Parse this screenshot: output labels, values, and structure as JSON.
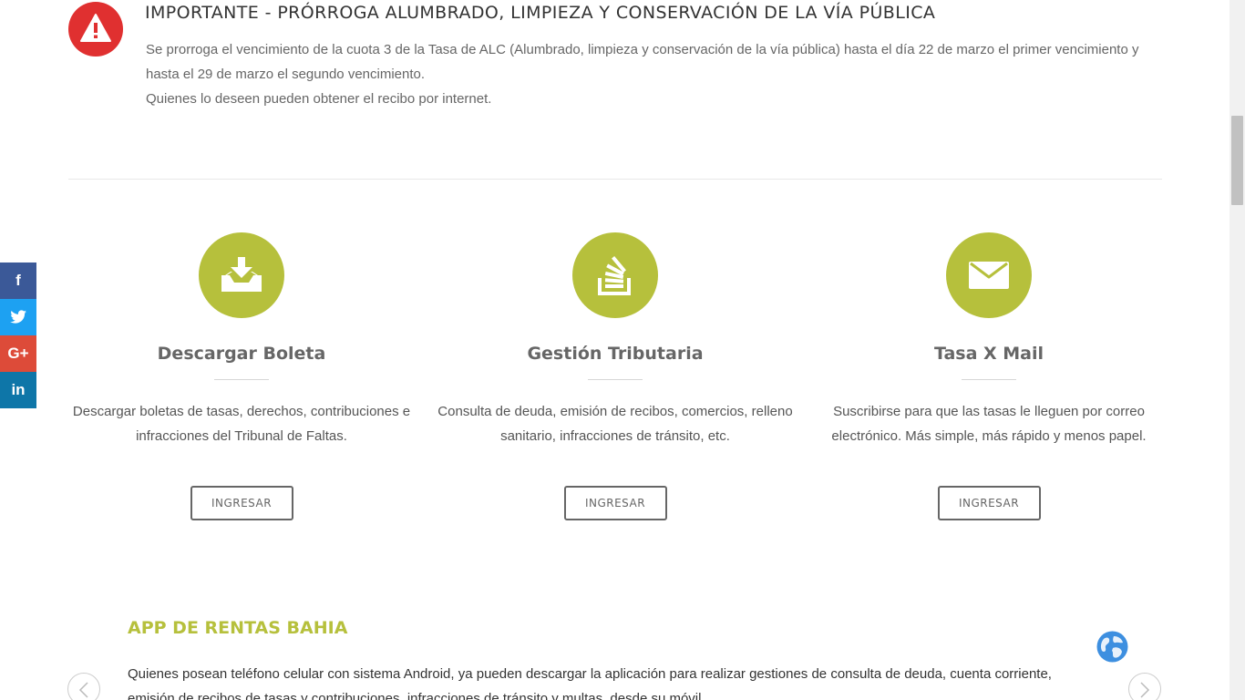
{
  "alert": {
    "title": "IMPORTANTE - PRÓRROGA ALUMBRADO, LIMPIEZA Y CONSERVACIÓN DE LA VÍA PÚBLICA",
    "body": "Se prorroga el vencimiento de la cuota 3 de la Tasa de ALC (Alumbrado, limpieza y conservación de la vía pública) hasta el día 22 de marzo el primer vencimiento y hasta el 29 de marzo el segundo vencimiento.",
    "note": "Quienes lo deseen pueden obtener el recibo por internet.",
    "icon": "warning-icon",
    "color": "#e03030"
  },
  "services": [
    {
      "icon": "download-inbox-icon",
      "title": "Descargar Boleta",
      "description": "Descargar boletas de tasas, derechos, contribuciones e infracciones del Tribunal de Faltas.",
      "button": "INGRESAR"
    },
    {
      "icon": "document-stack-icon",
      "title": "Gestión Tributaria",
      "description": "Consulta de deuda, emisión de recibos, comercios, relleno sanitario, infracciones de tránsito, etc.",
      "button": "INGRESAR"
    },
    {
      "icon": "envelope-icon",
      "title": "Tasa X Mail",
      "description": "Suscribirse para que las tasas le lleguen por correo electrónico. Más simple, más rápido y menos papel.",
      "button": "INGRESAR"
    }
  ],
  "app_section": {
    "title": "APP DE RENTAS BAHIA",
    "body": "Quienes posean teléfono celular con sistema Android, ya pueden descargar la aplicación para realizar gestiones de consulta de deuda, cuenta corriente, emisión de recibos de tasas y contribuciones, infracciones de tránsito y multas, desde su móvil."
  },
  "social": [
    {
      "name": "facebook",
      "label": "f",
      "color": "#3b5998"
    },
    {
      "name": "twitter",
      "label": "t",
      "color": "#1da1f2"
    },
    {
      "name": "google-plus",
      "label": "G+",
      "color": "#dd4b39"
    },
    {
      "name": "linkedin",
      "label": "in",
      "color": "#0e76a8"
    }
  ],
  "colors": {
    "accent": "#b6c03c",
    "alert": "#e03030",
    "text": "#666666"
  }
}
